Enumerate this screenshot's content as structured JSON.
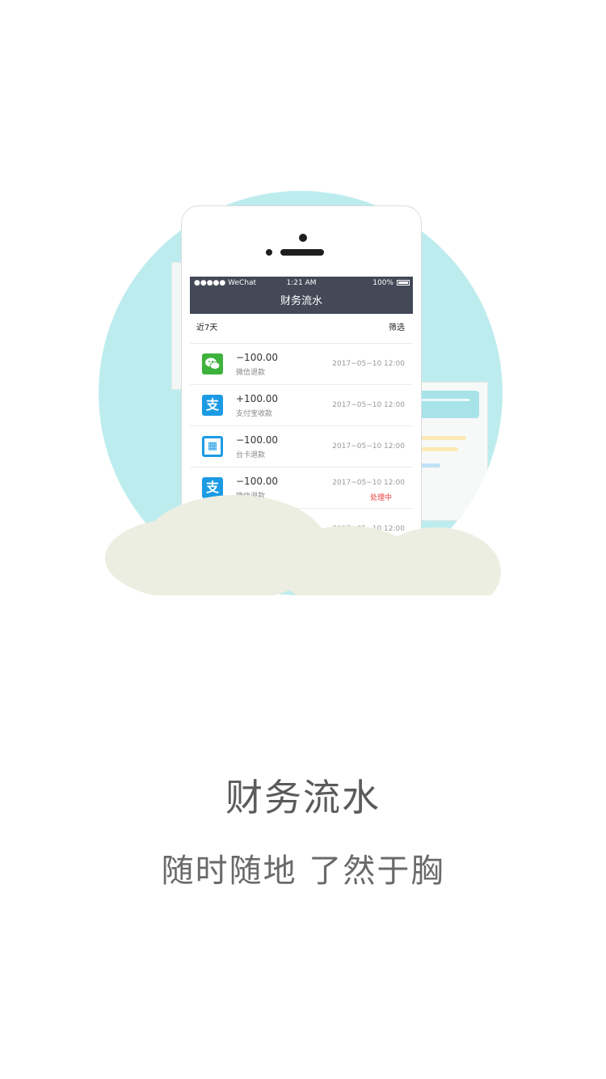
{
  "phone": {
    "status": {
      "carrier": "●●●●● WeChat",
      "time": "1:21 AM",
      "battery": "100%"
    },
    "nav_title": "财务流水",
    "range_label": "近7天",
    "filter_label": "筛选",
    "transactions": [
      {
        "icon": "wechat-icon",
        "amount": "−100.00",
        "desc": "微信退款",
        "datetime": "2017−05−10 12:00",
        "status": ""
      },
      {
        "icon": "alipay-icon",
        "amount": "+100.00",
        "desc": "支付宝收款",
        "datetime": "2017−05−10 12:00",
        "status": ""
      },
      {
        "icon": "qrcode-icon",
        "amount": "−100.00",
        "desc": "台卡退款",
        "datetime": "2017−05−10 12:00",
        "status": ""
      },
      {
        "icon": "alipay-icon",
        "amount": "−100.00",
        "desc": "微信退款",
        "datetime": "2017−05−10 12:00",
        "status": "处理中"
      },
      {
        "icon": "",
        "amount": "",
        "desc": "",
        "datetime": "2017−05−10 12:00",
        "status": ""
      }
    ]
  },
  "title": "财务流水",
  "subtitle": "随时随地 了然于胸",
  "colors": {
    "circle": "#bdecee",
    "navbar": "#434957",
    "cloud": "#eceee1",
    "wechat": "#3db23c",
    "alipay": "#1c9be4",
    "pending": "#e83a3a",
    "title_text": "#5b5b5b"
  }
}
